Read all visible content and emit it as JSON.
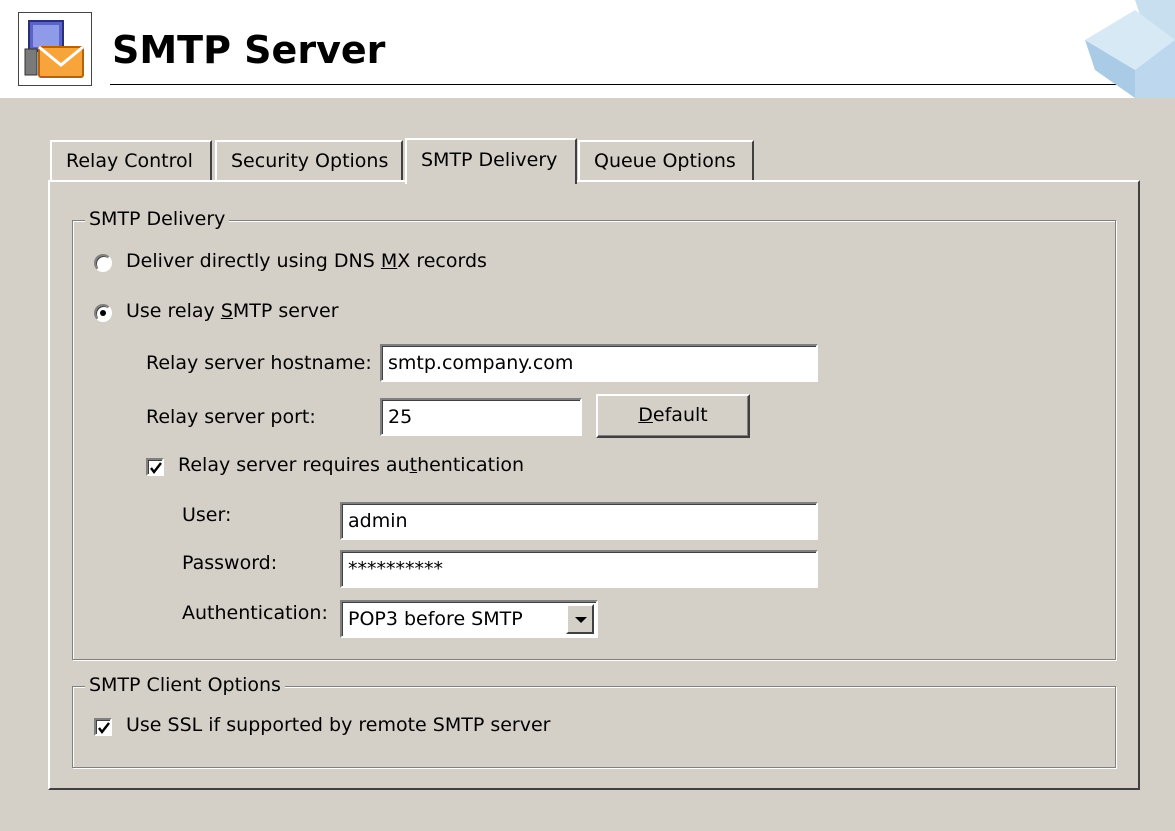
{
  "header": {
    "title": "SMTP Server"
  },
  "tabs": [
    {
      "label": "Relay Control"
    },
    {
      "label": "Security Options"
    },
    {
      "label": "SMTP Delivery"
    },
    {
      "label": "Queue Options"
    }
  ],
  "active_tab": "SMTP Delivery",
  "delivery_group": {
    "title": "SMTP Delivery",
    "option_dns_pre": "Deliver directly using DNS ",
    "option_dns_ul": "M",
    "option_dns_post": "X records",
    "option_relay_pre": "Use relay ",
    "option_relay_ul": "S",
    "option_relay_post": "MTP server",
    "selected": "relay",
    "hostname_label": "Relay server hostname:",
    "hostname_value": "smtp.company.com",
    "port_label": "Relay server port:",
    "port_value": "25",
    "default_button_ul": "D",
    "default_button_rest": "efault",
    "auth_check_pre": "Relay server requires au",
    "auth_check_ul": "t",
    "auth_check_post": "hentication",
    "auth_checked": true,
    "user_label": "User:",
    "user_value": "admin",
    "password_label": "Password:",
    "password_value": "**********",
    "auth_label": "Authentication:",
    "auth_value": "POP3 before SMTP"
  },
  "client_group": {
    "title": "SMTP Client Options",
    "ssl_label": "Use SSL if supported by remote SMTP server",
    "ssl_checked": true
  }
}
